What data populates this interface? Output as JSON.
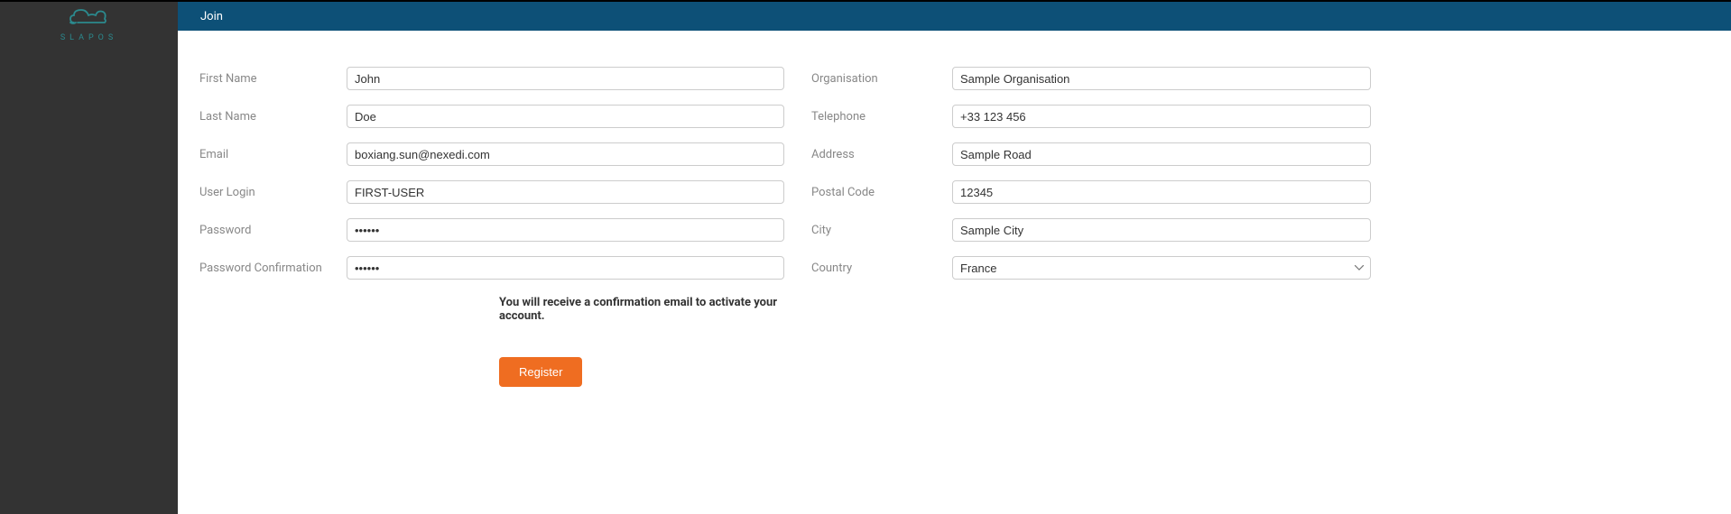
{
  "logo": {
    "text": "SLAPOS"
  },
  "header": {
    "title": "Join"
  },
  "form": {
    "left": {
      "first_name": {
        "label": "First Name",
        "value": "John"
      },
      "last_name": {
        "label": "Last Name",
        "value": "Doe"
      },
      "email": {
        "label": "Email",
        "value": "boxiang.sun@nexedi.com"
      },
      "user_login": {
        "label": "User Login",
        "value": "FIRST-USER"
      },
      "password": {
        "label": "Password",
        "value": "••••••"
      },
      "password_confirmation": {
        "label": "Password Confirmation",
        "value": "••••••"
      }
    },
    "right": {
      "organisation": {
        "label": "Organisation",
        "value": "Sample Organisation"
      },
      "telephone": {
        "label": "Telephone",
        "value": "+33 123 456"
      },
      "address": {
        "label": "Address",
        "value": "Sample Road"
      },
      "postal_code": {
        "label": "Postal Code",
        "value": "12345"
      },
      "city": {
        "label": "City",
        "value": "Sample City"
      },
      "country": {
        "label": "Country",
        "value": "France"
      }
    },
    "info_text": "You will receive a confirmation email to activate your account.",
    "register_button": "Register"
  }
}
